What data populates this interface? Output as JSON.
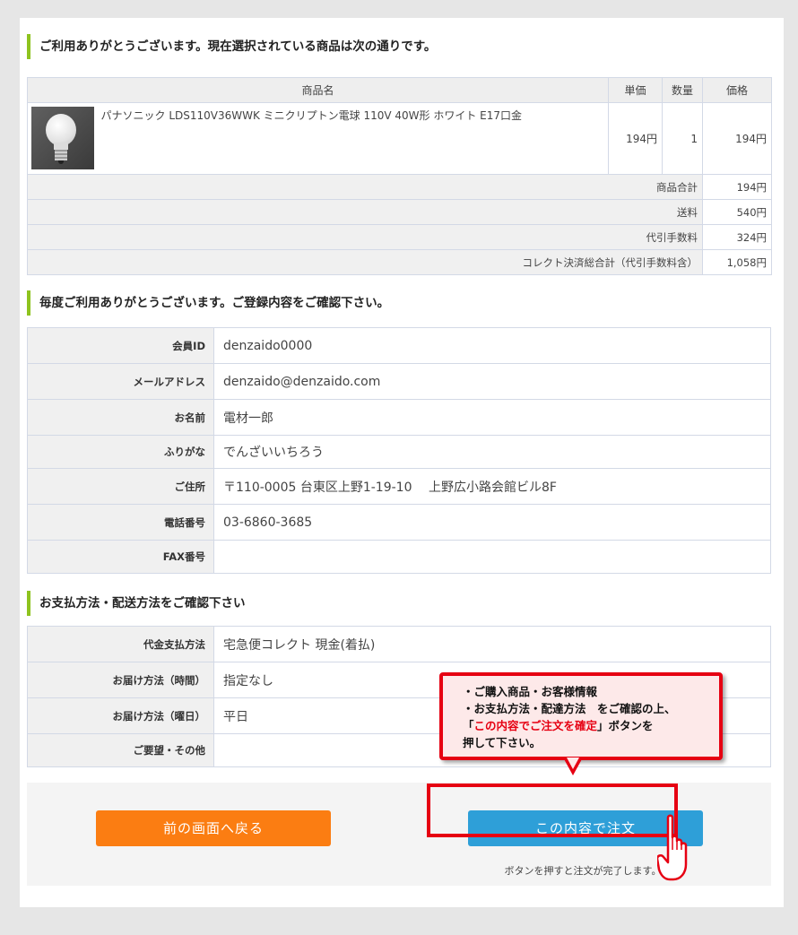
{
  "sections": {
    "cart_title": "ご利用ありがとうございます。現在選択されている商品は次の通りです。",
    "member_title": "毎度ご利用ありがとうございます。ご登録内容をご確認下さい。",
    "payment_title": "お支払方法・配送方法をご確認下さい"
  },
  "cart": {
    "headers": {
      "name": "商品名",
      "unit_price": "単価",
      "qty": "数量",
      "price": "価格"
    },
    "item": {
      "image_icon": "light-bulb-image",
      "name": "パナソニック LDS110V36WWK ミニクリプトン電球 110V 40W形 ホワイト E17口金",
      "unit_price": "194円",
      "qty": "1",
      "price": "194円"
    },
    "summary": [
      {
        "label": "商品合計",
        "value": "194円"
      },
      {
        "label": "送料",
        "value": "540円"
      },
      {
        "label": "代引手数料",
        "value": "324円"
      },
      {
        "label": "コレクト決済総合計（代引手数料含）",
        "value": "1,058円"
      }
    ]
  },
  "member": [
    {
      "label": "会員ID",
      "value": "denzaido0000"
    },
    {
      "label": "メールアドレス",
      "value": "denzaido@denzaido.com"
    },
    {
      "label": "お名前",
      "value": "電材一郎"
    },
    {
      "label": "ふりがな",
      "value": "でんざいいちろう"
    },
    {
      "label": "ご住所",
      "value": "〒110-0005 台東区上野1-19-10　 上野広小路会館ビル8F"
    },
    {
      "label": "電話番号",
      "value": "03-6860-3685"
    },
    {
      "label": "FAX番号",
      "value": ""
    }
  ],
  "payment": [
    {
      "label": "代金支払方法",
      "value": "宅急便コレクト 現金(着払)"
    },
    {
      "label": "お届け方法（時間）",
      "value": "指定なし"
    },
    {
      "label": "お届け方法（曜日）",
      "value": "平日"
    },
    {
      "label": "ご要望・その他",
      "value": ""
    }
  ],
  "buttons": {
    "back": "前の画面へ戻る",
    "order": "この内容で注文",
    "note": "ボタンを押すと注文が完了します。"
  },
  "callout": {
    "line1": "・ご購入商品・お客様情報",
    "line2": "・お支払方法・配達方法　をご確認の上、",
    "line3_pre": "「",
    "line3_highlight": "この内容でご注文を確定",
    "line3_post": "」ボタンを",
    "line4": "押して下さい。"
  },
  "colors": {
    "accent_green": "#8ec31f",
    "back_button": "#fb7d12",
    "order_button": "#2e9fd8",
    "alert_red": "#e60012"
  }
}
